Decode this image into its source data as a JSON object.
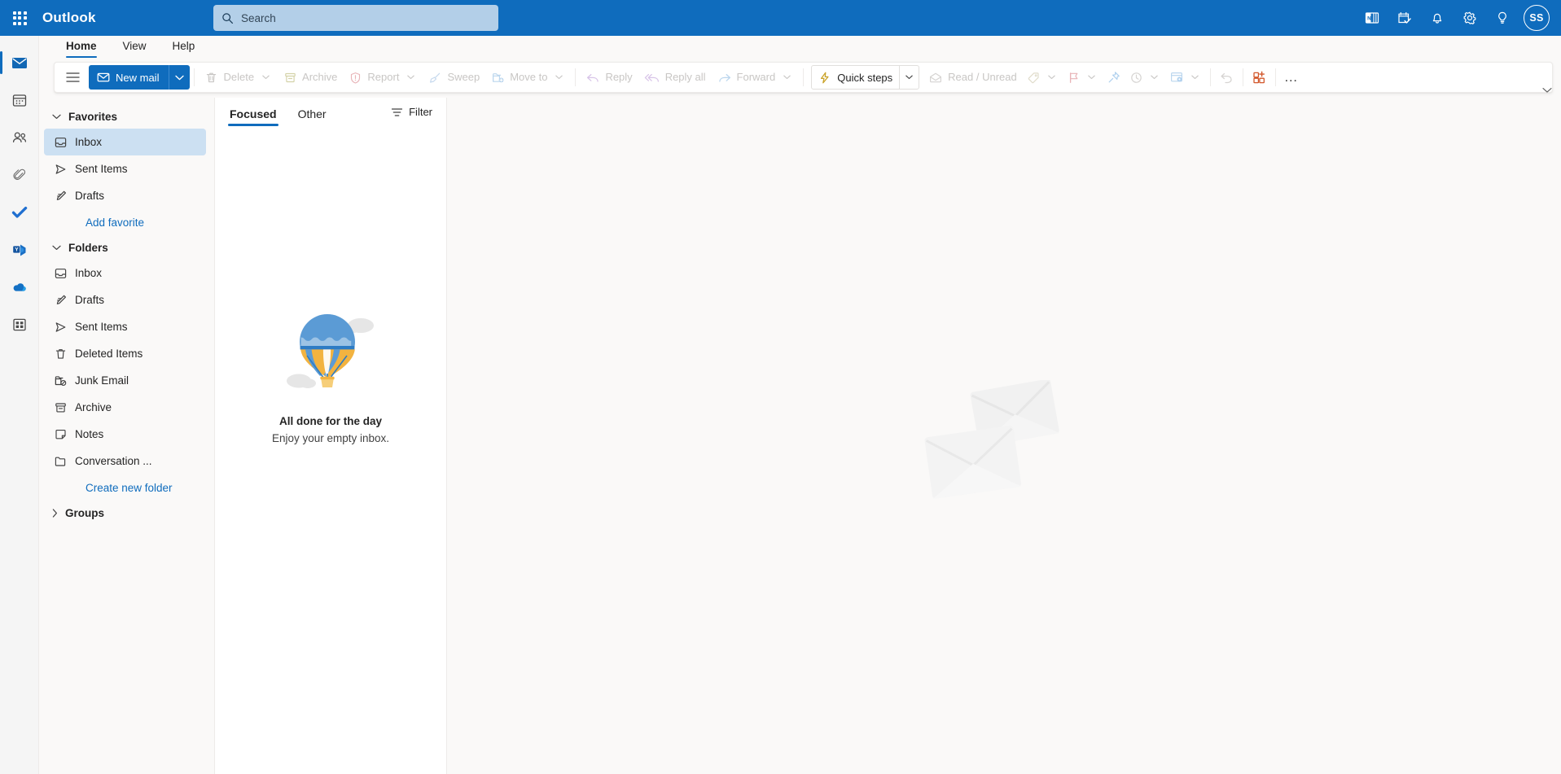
{
  "header": {
    "waffle_label": "app-launcher",
    "brand": "Outlook",
    "search": {
      "placeholder": "Search",
      "value": ""
    },
    "icons": [
      {
        "name": "onenote-feed-icon",
        "label": "My Day / OneNote feed"
      },
      {
        "name": "todo-calendar-icon",
        "label": "To Do"
      },
      {
        "name": "bell-icon",
        "label": "Notifications"
      },
      {
        "name": "gear-icon",
        "label": "Settings"
      },
      {
        "name": "lightbulb-icon",
        "label": "Tips & Feedback"
      }
    ],
    "avatar_initials": "SS",
    "background_color": "#0F6CBD"
  },
  "rail": {
    "items": [
      {
        "name": "rail-item-mail",
        "label": "Mail",
        "active": true
      },
      {
        "name": "rail-item-calendar",
        "label": "Calendar",
        "active": false
      },
      {
        "name": "rail-item-people",
        "label": "People",
        "active": false
      },
      {
        "name": "rail-item-files",
        "label": "Files",
        "active": false
      },
      {
        "name": "rail-item-todo",
        "label": "To Do",
        "active": false
      },
      {
        "name": "rail-item-viva-engage",
        "label": "Viva Engage",
        "active": false
      },
      {
        "name": "rail-item-onedrive",
        "label": "OneDrive",
        "active": false
      },
      {
        "name": "rail-item-apps",
        "label": "Apps",
        "active": false
      }
    ]
  },
  "ribbon": {
    "tabs": [
      {
        "label": "Home",
        "active": true
      },
      {
        "label": "View",
        "active": false
      },
      {
        "label": "Help",
        "active": false
      }
    ],
    "new_mail": "New mail",
    "commands": [
      {
        "label": "Delete",
        "icon": "trash-icon",
        "disabled": true,
        "caret": true
      },
      {
        "label": "Archive",
        "icon": "archive-icon",
        "disabled": true,
        "caret": false
      },
      {
        "label": "Report",
        "icon": "shield-alert-icon",
        "disabled": true,
        "caret": true
      },
      {
        "label": "Sweep",
        "icon": "broom-icon",
        "disabled": true,
        "caret": false
      },
      {
        "label": "Move to",
        "icon": "move-folder-icon",
        "disabled": true,
        "caret": true
      },
      {
        "label": "Reply",
        "icon": "reply-arrow-icon",
        "disabled": true,
        "caret": false
      },
      {
        "label": "Reply all",
        "icon": "reply-all-arrow-icon",
        "disabled": true,
        "caret": false
      },
      {
        "label": "Forward",
        "icon": "forward-arrow-icon",
        "disabled": true,
        "caret": true
      }
    ],
    "quick_steps": "Quick steps",
    "read_unread": "Read / Unread",
    "icon_commands": [
      {
        "name": "tag-icon",
        "label": "Categorize",
        "disabled": true,
        "caret": true
      },
      {
        "name": "flag-icon",
        "label": "Flag",
        "disabled": true,
        "caret": true
      },
      {
        "name": "pin-icon",
        "label": "Pin",
        "disabled": true,
        "caret": false
      },
      {
        "name": "snooze-clock-icon",
        "label": "Snooze",
        "disabled": true,
        "caret": true
      },
      {
        "name": "rules-icon",
        "label": "Rules",
        "disabled": true,
        "caret": true
      },
      {
        "name": "undo-icon",
        "label": "Undo",
        "disabled": true,
        "caret": false
      },
      {
        "name": "add-apps-icon",
        "label": "Apps",
        "disabled": false,
        "caret": false
      }
    ],
    "overflow": "…"
  },
  "sidebar": {
    "favorites": {
      "title": "Favorites",
      "expanded": true,
      "items": [
        {
          "label": "Inbox",
          "icon": "inbox-icon",
          "selected": true
        },
        {
          "label": "Sent Items",
          "icon": "sent-icon",
          "selected": false
        },
        {
          "label": "Drafts",
          "icon": "drafts-icon",
          "selected": false
        }
      ],
      "add_link": "Add favorite"
    },
    "folders": {
      "title": "Folders",
      "expanded": true,
      "items": [
        {
          "label": "Inbox",
          "icon": "inbox-icon",
          "selected": false
        },
        {
          "label": "Drafts",
          "icon": "drafts-icon",
          "selected": false
        },
        {
          "label": "Sent Items",
          "icon": "sent-icon",
          "selected": false
        },
        {
          "label": "Deleted Items",
          "icon": "trash-icon",
          "selected": false
        },
        {
          "label": "Junk Email",
          "icon": "junk-icon",
          "selected": false
        },
        {
          "label": "Archive",
          "icon": "archive-icon",
          "selected": false
        },
        {
          "label": "Notes",
          "icon": "notes-icon",
          "selected": false
        },
        {
          "label": "Conversation ...",
          "icon": "folder-icon",
          "selected": false
        }
      ],
      "create_link": "Create new folder"
    },
    "groups": {
      "title": "Groups",
      "expanded": false
    }
  },
  "message_list": {
    "tabs": [
      {
        "label": "Focused",
        "active": true
      },
      {
        "label": "Other",
        "active": false
      }
    ],
    "filter_label": "Filter",
    "empty_state": {
      "illustration": "hot-air-balloon-illustration",
      "title": "All done for the day",
      "subtitle": "Enjoy your empty inbox."
    }
  },
  "reading_pane": {
    "watermark": "envelopes-watermark"
  },
  "colors": {
    "accent": "#0F6CBD",
    "header": "#0F6CBD",
    "selected_item": "#CCE0F2",
    "surface": "#FAF9F8",
    "balloon_blue": "#5B9BD5",
    "balloon_orange": "#F2B340"
  }
}
